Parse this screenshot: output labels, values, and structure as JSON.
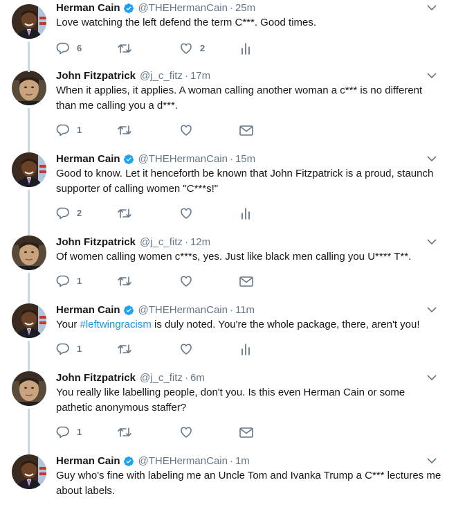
{
  "tweets": [
    {
      "name": "Herman Cain",
      "verified": true,
      "handle": "@THEHermanCain",
      "dot": "·",
      "time": "25m",
      "text": "Love watching the left defend the term C***.  Good times.",
      "reply_count": "6",
      "retweet_count": "",
      "like_count": "2",
      "last_action": "analytics-icon",
      "avatar": "herman"
    },
    {
      "name": "John Fitzpatrick",
      "verified": false,
      "handle": "@j_c_fitz",
      "dot": "·",
      "time": "17m",
      "text": "When it applies, it applies. A woman calling another woman a c*** is no different than me calling you a d***.",
      "reply_count": "1",
      "retweet_count": "",
      "like_count": "",
      "last_action": "direct-message-icon",
      "avatar": "john"
    },
    {
      "name": "Herman Cain",
      "verified": true,
      "handle": "@THEHermanCain",
      "dot": "·",
      "time": "15m",
      "text": "Good to know. Let it henceforth be known that John Fitzpatrick is a proud, staunch supporter of calling women \"C***s!\"",
      "reply_count": "2",
      "retweet_count": "",
      "like_count": "",
      "last_action": "analytics-icon",
      "avatar": "herman"
    },
    {
      "name": "John Fitzpatrick",
      "verified": false,
      "handle": "@j_c_fitz",
      "dot": "·",
      "time": "12m",
      "text": "Of women calling women c***s, yes. Just like black men calling you U**** T**.",
      "reply_count": "1",
      "retweet_count": "",
      "like_count": "",
      "last_action": "direct-message-icon",
      "avatar": "john"
    },
    {
      "name": "Herman Cain",
      "verified": true,
      "handle": "@THEHermanCain",
      "dot": "·",
      "time": "11m",
      "text_pre": "Your ",
      "hashtag": "#leftwingracism",
      "text_post": " is duly noted.  You're the whole package, there, aren't you!",
      "reply_count": "1",
      "retweet_count": "",
      "like_count": "",
      "last_action": "analytics-icon",
      "avatar": "herman"
    },
    {
      "name": "John Fitzpatrick",
      "verified": false,
      "handle": "@j_c_fitz",
      "dot": "·",
      "time": "6m",
      "text": "You really like labelling people, don't you. Is this even Herman Cain or some pathetic anonymous staffer?",
      "reply_count": "1",
      "retweet_count": "",
      "like_count": "",
      "last_action": "direct-message-icon",
      "avatar": "john"
    },
    {
      "name": "Herman Cain",
      "verified": true,
      "handle": "@THEHermanCain",
      "dot": "·",
      "time": "1m",
      "text": "Guy who's fine with labeling me an Uncle Tom and Ivanka Trump a C*** lectures me about labels.",
      "avatar": "herman"
    }
  ],
  "colors": {
    "verified": "#1da1f2",
    "icon": "#657786",
    "hashtag": "#1b95e0",
    "thread_line": "#c4d8e6"
  }
}
